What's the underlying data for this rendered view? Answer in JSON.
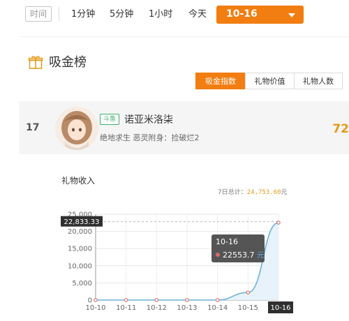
{
  "time_filter": {
    "label": "时间",
    "options": [
      "1分钟",
      "5分钟",
      "1小时",
      "今天"
    ],
    "selected_date": "10-16",
    "accent_color": "#f27d10"
  },
  "section": {
    "title": "吸金榜",
    "icon": "gift-icon"
  },
  "metric_tabs": [
    {
      "label": "吸金指数",
      "active": true
    },
    {
      "label": "礼物价值",
      "active": false
    },
    {
      "label": "礼物人数",
      "active": false
    }
  ],
  "ranking_row": {
    "rank": "17",
    "platform_badge": "斗鱼",
    "name": "诺亚米洛柒",
    "description": "绝地求生 恶灵附身：捡破烂2",
    "value": "72"
  },
  "chart_section": {
    "title": "礼物收入",
    "weekly_total_label": "7日总计：",
    "weekly_total_value": "24,753.60",
    "weekly_total_unit": "元"
  },
  "chart_data": {
    "type": "area",
    "x": [
      "10-10",
      "10-11",
      "10-12",
      "10-13",
      "10-14",
      "10-15",
      "10-16"
    ],
    "values": [
      0,
      0,
      0,
      0,
      0,
      2200,
      22553.7
    ],
    "ylim": [
      0,
      25000
    ],
    "y_ticks": [
      "0",
      "5,000",
      "10,000",
      "15,000",
      "20,000",
      "25,000"
    ],
    "grid": true,
    "line_color": "#6bb4d6",
    "markLine": {
      "label": "22,833.33",
      "value": 22833.33
    },
    "tooltip": {
      "date": "10-16",
      "value": "22553.7",
      "unit": "元"
    },
    "highlight_x": "10-16"
  }
}
